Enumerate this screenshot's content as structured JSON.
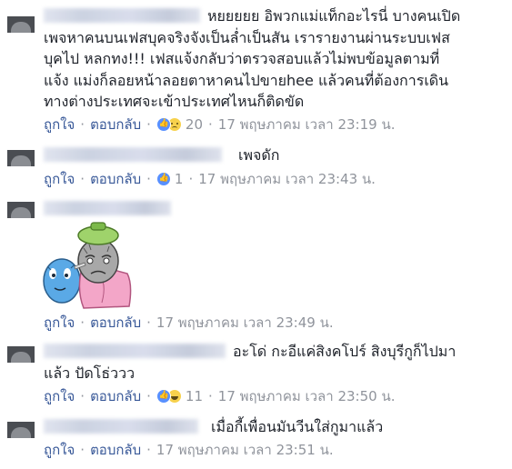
{
  "comments": [
    {
      "text": "หยยยยย อิพวกแม่แท็กอะไรนี่ บางคนเปิด\nเพจหาคนบนเฟสบุคจริงจังเป็นล่ำเป็นสัน เรารายงานผ่านระบบเฟส\nบุคไป หลกทง!!! เฟสแจ้งกลับว่าตรวจสอบแล้วไม่พบข้อมูลตามที่\nแจ้ง แม่งก็ลอยหน้าลอยตาหาคนไปขายhee แล้วคนที่ต้องการเดิน\nทางต่างประเทศจะเข้าประเทศไหนก็ติดขัด",
      "like_label": "ถูกใจ",
      "reply_label": "ตอบกลับ",
      "reactions": [
        "like",
        "sad"
      ],
      "reaction_count": "20",
      "time": "17 พฤษภาคม เวลา 23:19 น."
    },
    {
      "text": "เพจดัก",
      "like_label": "ถูกใจ",
      "reply_label": "ตอบกลับ",
      "reactions": [
        "like"
      ],
      "reaction_count": "1",
      "time": "17 พฤษภาคม เวลา 23:43 น."
    },
    {
      "text": "",
      "like_label": "ถูกใจ",
      "reply_label": "ตอบกลับ",
      "reactions": [],
      "reaction_count": "",
      "time": "17 พฤษภาคม เวลา 23:49 น."
    },
    {
      "text": "อะโด่ กะอีแค่สิงคโปร์ สิงบุรีกูก็ไปมา\nแล้ว ปัดโธ่ววว",
      "like_label": "ถูกใจ",
      "reply_label": "ตอบกลับ",
      "reactions": [
        "like",
        "haha"
      ],
      "reaction_count": "11",
      "time": "17 พฤษภาคม เวลา 23:50 น."
    },
    {
      "text": "เมื่อกี้เพื่อนมันวีนใส่กูมาแล้ว",
      "like_label": "ถูกใจ",
      "reply_label": "ตอบกลับ",
      "reactions": [],
      "reaction_count": "",
      "time": "17 พฤษภาคม เวลา 23:51 น."
    }
  ],
  "separator": "·",
  "colors": {
    "link": "#385898",
    "meta": "#90949c",
    "text": "#1d2129",
    "like": "#5890ff",
    "emoji": "#f7d14c"
  }
}
